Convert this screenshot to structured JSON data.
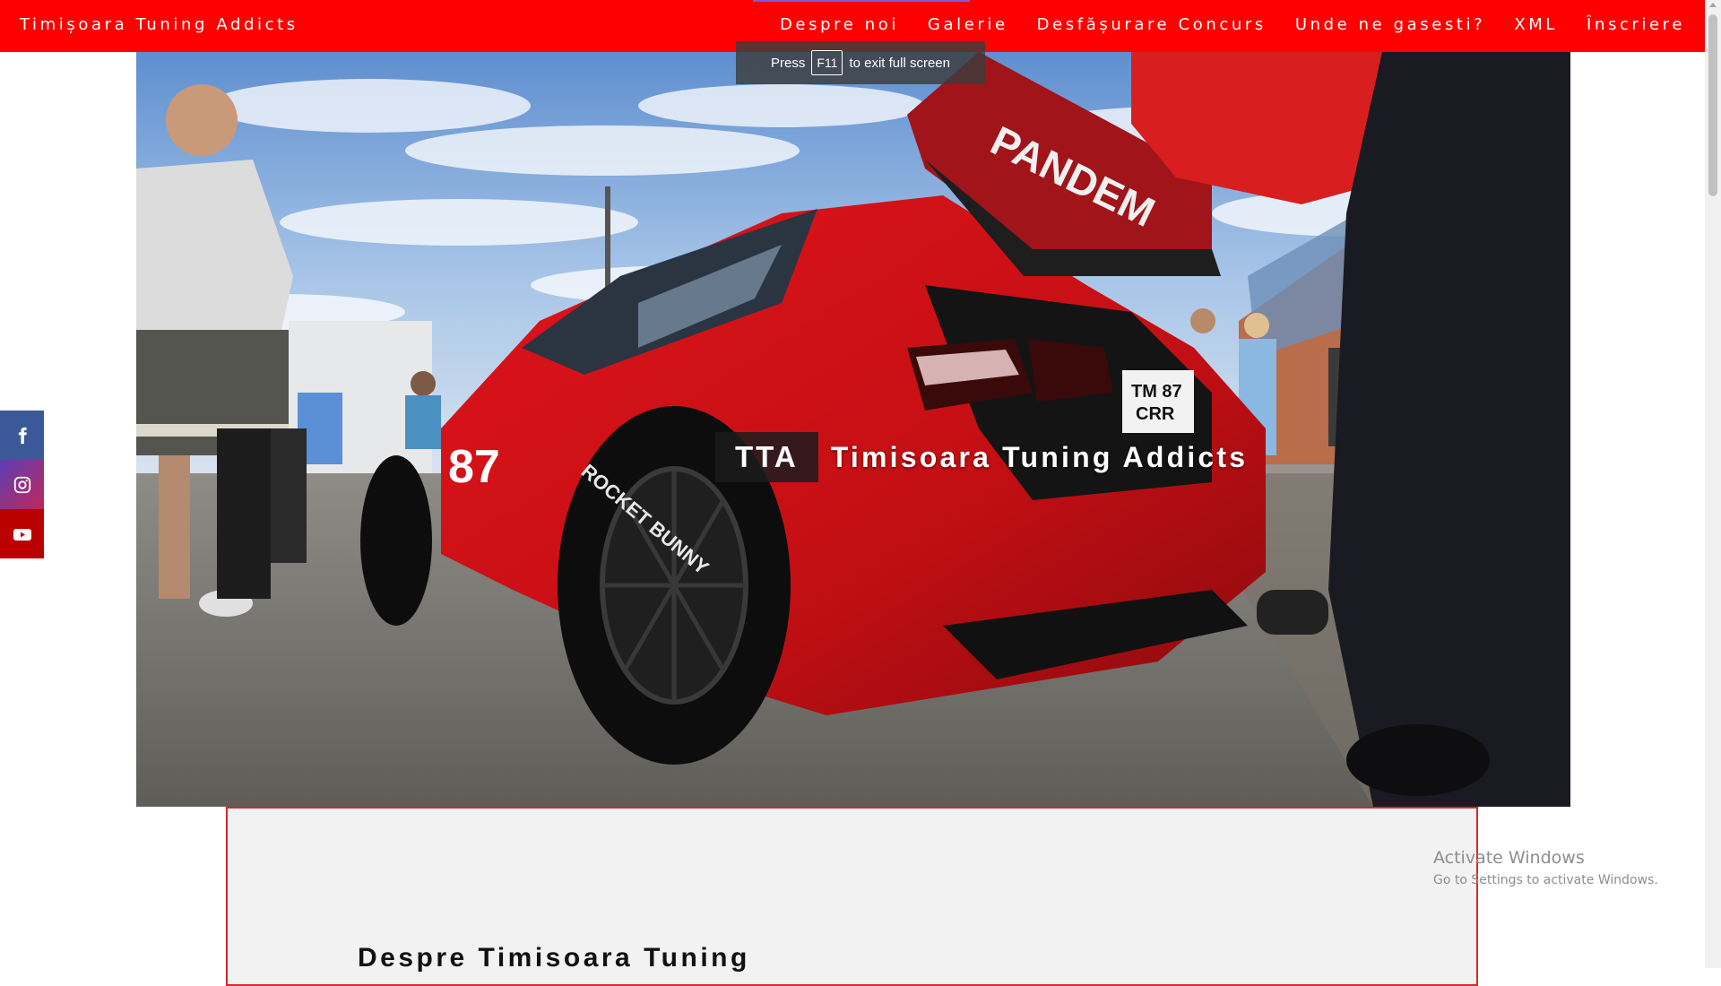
{
  "site": {
    "brand": "Timișoara Tuning Addicts",
    "brand_color": "#ff0000"
  },
  "nav": {
    "items": [
      {
        "label": "Despre noi"
      },
      {
        "label": "Galerie"
      },
      {
        "label": "Desfășurare Concurs"
      },
      {
        "label": "Unde ne gasesti?"
      },
      {
        "label": "XML"
      },
      {
        "label": "Înscriere"
      }
    ]
  },
  "fullscreen_toast": {
    "prefix": "Press",
    "key": "F11",
    "suffix": "to exit full screen"
  },
  "hero": {
    "abbr": "TTA",
    "title": "Timisoara Tuning Addicts",
    "car_text": {
      "wing": "PANDEM",
      "number": "87",
      "plate_top": "TM 87",
      "plate_bottom": "CRR",
      "tire": "ROCKET BUNNY"
    }
  },
  "social": {
    "items": [
      {
        "icon": "facebook-icon",
        "glyph": "f",
        "color": "#3b5998"
      },
      {
        "icon": "instagram-icon",
        "color": "#8a2d8f"
      },
      {
        "icon": "youtube-icon",
        "glyph": "You",
        "color": "#bb0000"
      }
    ]
  },
  "about": {
    "heading": "Despre Timisoara Tuning"
  },
  "watermark": {
    "line1": "Activate Windows",
    "line2": "Go to Settings to activate Windows."
  }
}
